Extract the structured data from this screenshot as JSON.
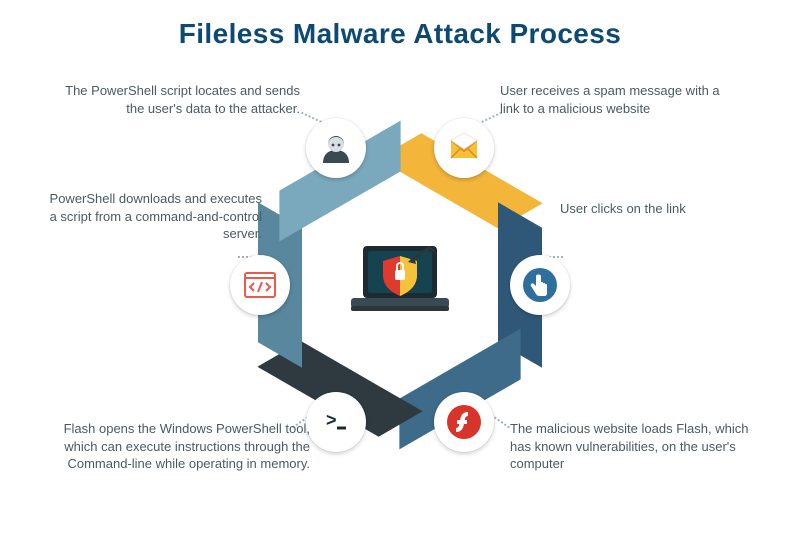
{
  "title": "Fileless Malware Attack Process",
  "steps": {
    "mail": {
      "label": "User receives a spam message with a link to a malicious website"
    },
    "click": {
      "label": "User clicks on the link"
    },
    "flash": {
      "label": "The malicious website loads Flash, which has known vulnerabilities, on the user's computer"
    },
    "shell": {
      "label": "Flash opens the Windows PowerShell tool, which can execute instructions through the Command-line while operating in memory."
    },
    "c2": {
      "label": "PowerShell downloads and executes a script from a command-and-control server."
    },
    "exfil": {
      "label": "The PowerShell script locates and sends the user's data to the attacker."
    }
  },
  "colors": {
    "seg_mail": "#f3b53a",
    "seg_click": "#2f5878",
    "seg_flash": "#3d6b89",
    "seg_shell": "#2f3a40",
    "seg_c2": "#58879e",
    "seg_exfil": "#7aa9bd",
    "title": "#0d4a73"
  },
  "icons": {
    "mail": "envelope-icon",
    "click": "pointer-icon",
    "flash": "flash-icon",
    "shell": "terminal-icon",
    "c2": "code-icon",
    "exfil": "hacker-icon",
    "center": "laptop-shield-icon"
  }
}
